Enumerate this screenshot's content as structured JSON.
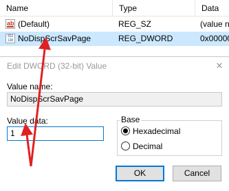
{
  "list": {
    "columns": {
      "name": "Name",
      "type": "Type",
      "data": "Data"
    },
    "rows": [
      {
        "icon": "string-value-icon",
        "icon_text": "ab",
        "name": "(Default)",
        "type": "REG_SZ",
        "data": "(value n"
      },
      {
        "icon": "binary-value-icon",
        "icon_text": "011 110",
        "name": "NoDispScrSavPage",
        "type": "REG_DWORD",
        "data": "0x000000"
      }
    ]
  },
  "dialog": {
    "title": "Edit DWORD (32-bit) Value",
    "close_glyph": "✕",
    "value_name_label": "Value name:",
    "value_name": "NoDispScrSavPage",
    "value_data_label": "Value data:",
    "value_data": "1",
    "base_label": "Base",
    "base_options": [
      {
        "label": "Hexadecimal",
        "selected": true
      },
      {
        "label": "Decimal",
        "selected": false
      }
    ],
    "ok_label": "OK",
    "cancel_label": "Cancel"
  },
  "annotation": {
    "color": "#e02020"
  }
}
